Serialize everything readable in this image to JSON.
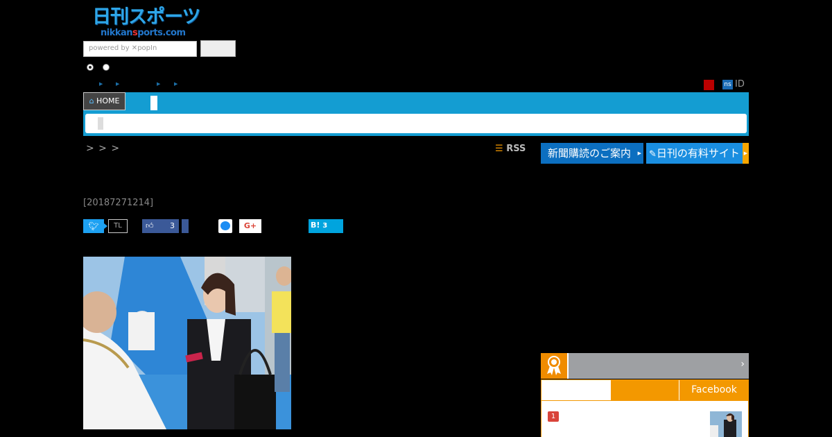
{
  "logo": {
    "jp": "日刊スポーツ",
    "en_pre": "nikkan",
    "en_mid": "s",
    "en_post": "ports.com"
  },
  "search": {
    "powered_by": "powered by ✕popIn"
  },
  "header": {
    "id_label": "ID",
    "ns_badge": "ns"
  },
  "nav": {
    "home_label": "HOME"
  },
  "breadcrumb": {
    "text": "> > >"
  },
  "rss": {
    "label": "RSS",
    "icon": "rss-icon"
  },
  "banners": {
    "subscribe": "新聞購読のご案内",
    "paid_site": "日刊の有料サイト"
  },
  "article": {
    "dateline": "[20187271214]"
  },
  "share": {
    "twitter_icon": "twitter-bird-icon",
    "tl_label": "TL",
    "facebook_count": "3",
    "google_plus": "G+",
    "hatena_label": "B!",
    "hatena_count": "3"
  },
  "ranking": {
    "tab_facebook": "Facebook",
    "first_rank": "1",
    "chevron": "›"
  },
  "colors": {
    "nav_blue": "#149dd2",
    "ranking_orange": "#f39800",
    "subscribe_blue": "#0c6fc0"
  }
}
